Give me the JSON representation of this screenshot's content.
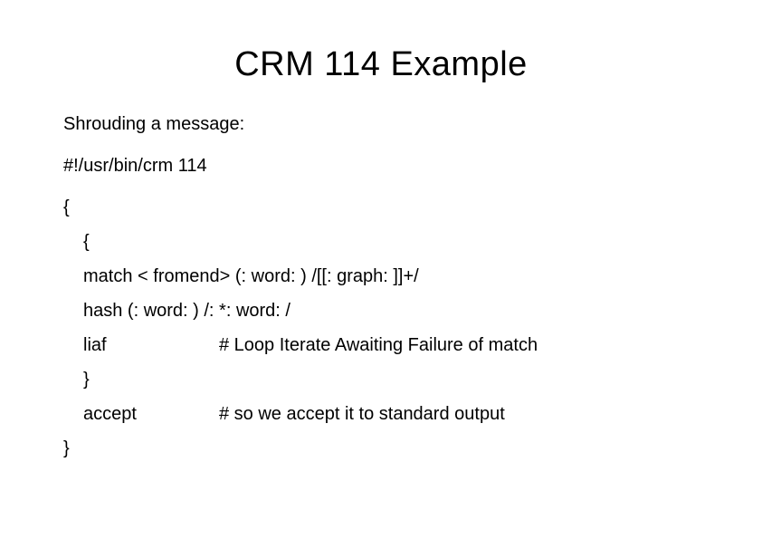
{
  "title": "CRM 114 Example",
  "lines": {
    "intro": "Shrouding a message:",
    "shebang": "#!/usr/bin/crm 114",
    "brace_open1": "{",
    "brace_open2": "{",
    "match": "match < fromend> (: word: ) /[[: graph: ]]+/",
    "hash": "hash (: word: ) /: *: word: /",
    "liaf": "liaf",
    "liaf_comment": "# Loop Iterate Awaiting Failure of match",
    "brace_close1": "}",
    "accept": "accept",
    "accept_comment": "# so we accept it to standard output",
    "brace_close2": "}"
  }
}
